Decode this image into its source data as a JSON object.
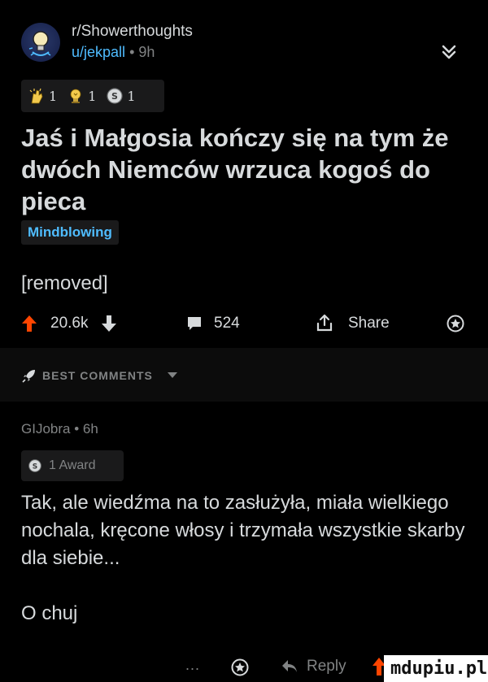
{
  "post": {
    "subreddit": "r/Showerthoughts",
    "author": "u/jekpall",
    "age": "9h",
    "awards": [
      {
        "icon": "clapping-hands-icon",
        "count": "1"
      },
      {
        "icon": "trophy-bulb-icon",
        "count": "1"
      },
      {
        "icon": "silver-coin-icon",
        "count": "1"
      }
    ],
    "title": "Jaś i Małgosia kończy się na tym że dwóch Niemców wrzuca kogoś do pieca",
    "flair": "Mindblowing",
    "body": "[removed]",
    "score": "20.6k",
    "comment_count": "524",
    "share_label": "Share"
  },
  "sort": {
    "label": "BEST COMMENTS"
  },
  "comment": {
    "author": "GIJobra",
    "age": "6h",
    "meta_separator": "•",
    "award_label": "1 Award",
    "paragraphs": [
      "Tak, ale wiedźma na to zasłużyła, miała wielkiego nochala, kręcone włosy i trzymała wszystkie skarby dla siebie...",
      "O chuj"
    ],
    "more_label": "...",
    "reply_label": "Reply"
  },
  "watermark": "mdupiu.pl",
  "colors": {
    "background": "#000000",
    "text": "#d7dadc",
    "muted": "#818384",
    "link": "#4fbcff",
    "chip": "#1a1a1b"
  }
}
